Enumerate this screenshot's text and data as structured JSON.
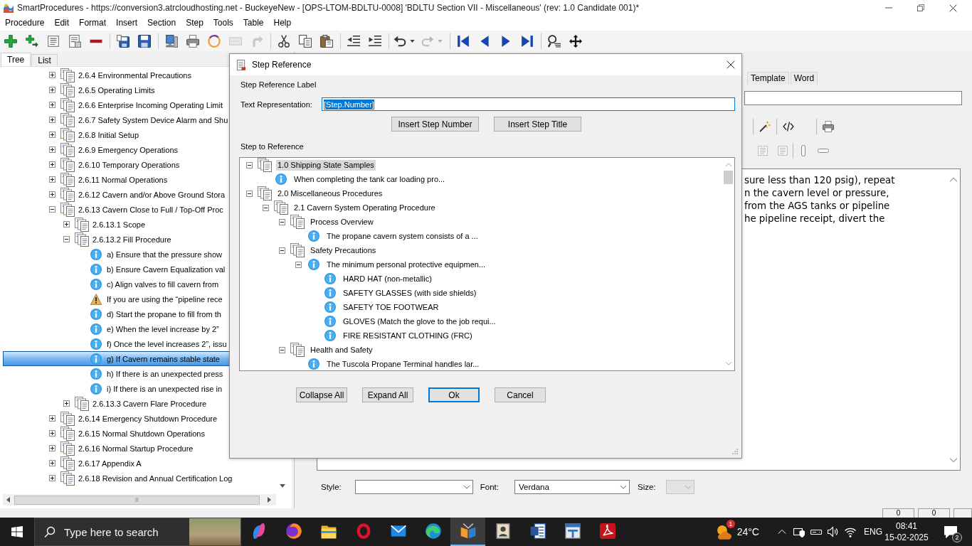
{
  "window": {
    "title": "SmartProcedures - https://conversion3.atrcloudhosting.net - BuckeyeNew - [OPS-LTOM-BDLTU-0008] 'BDLTU Section VII - Miscellaneous' (rev: 1.0 Candidate 001)*"
  },
  "menu": [
    "Procedure",
    "Edit",
    "Format",
    "Insert",
    "Section",
    "Step",
    "Tools",
    "Table",
    "Help"
  ],
  "toolbar": [
    {
      "kind": "plus",
      "disabled": false
    },
    {
      "kind": "plus-arrow",
      "disabled": false
    },
    {
      "kind": "list",
      "disabled": false
    },
    {
      "kind": "list-doc",
      "disabled": false
    },
    {
      "kind": "minus",
      "disabled": false
    },
    {
      "kind": "separator"
    },
    {
      "kind": "save-as",
      "disabled": false
    },
    {
      "kind": "save",
      "disabled": false
    },
    {
      "kind": "separator"
    },
    {
      "kind": "monitor",
      "disabled": false
    },
    {
      "kind": "printer",
      "disabled": false
    },
    {
      "kind": "ring",
      "disabled": false
    },
    {
      "kind": "card",
      "disabled": true
    },
    {
      "kind": "curve-arrow",
      "disabled": true
    },
    {
      "kind": "separator"
    },
    {
      "kind": "scissors",
      "disabled": false
    },
    {
      "kind": "copy",
      "disabled": false
    },
    {
      "kind": "paste",
      "disabled": false
    },
    {
      "kind": "separator"
    },
    {
      "kind": "outdent",
      "disabled": false
    },
    {
      "kind": "indent",
      "disabled": false
    },
    {
      "kind": "separator"
    },
    {
      "kind": "undo",
      "disabled": false
    },
    {
      "kind": "redo",
      "disabled": true
    },
    {
      "kind": "separator"
    },
    {
      "kind": "first",
      "disabled": false
    },
    {
      "kind": "prev",
      "disabled": false
    },
    {
      "kind": "next",
      "disabled": false
    },
    {
      "kind": "last",
      "disabled": false
    },
    {
      "kind": "separator"
    },
    {
      "kind": "find",
      "disabled": false
    },
    {
      "kind": "move",
      "disabled": false
    }
  ],
  "left_pane": {
    "tabs": [
      {
        "label": "Tree",
        "selected": true
      },
      {
        "label": "List",
        "selected": false
      }
    ],
    "tree": [
      {
        "label": "2.6.4 Environmental Precautions",
        "kind": "section",
        "expanded": false,
        "selected": false
      },
      {
        "label": "2.6.5 Operating Limits",
        "kind": "section",
        "expanded": false,
        "selected": false
      },
      {
        "label": "2.6.6 Enterprise Incoming Operating Limit",
        "kind": "section",
        "expanded": false,
        "selected": false
      },
      {
        "label": "2.6.7 Safety System Device Alarm and Shu",
        "kind": "section",
        "expanded": false,
        "selected": false
      },
      {
        "label": "2.6.8 Initial Setup",
        "kind": "section",
        "expanded": false,
        "selected": false
      },
      {
        "label": "2.6.9 Emergency Operations",
        "kind": "section",
        "expanded": false,
        "selected": false
      },
      {
        "label": "2.6.10 Temporary Operations",
        "kind": "section",
        "expanded": false,
        "selected": false
      },
      {
        "label": "2.6.11 Normal Operations",
        "kind": "section",
        "expanded": false,
        "selected": false
      },
      {
        "label": "2.6.12 Cavern and/or Above Ground Stora",
        "kind": "section",
        "expanded": false,
        "selected": false
      },
      {
        "label": "2.6.13 Cavern Close to Full / Top-Off Proc",
        "kind": "section",
        "expanded": true,
        "selected": false,
        "children": [
          {
            "label": "2.6.13.1 Scope",
            "kind": "section",
            "expanded": false,
            "selected": false
          },
          {
            "label": "2.6.13.2 Fill Procedure",
            "kind": "section",
            "expanded": true,
            "selected": false,
            "children": [
              {
                "label": "a) Ensure that the pressure show",
                "kind": "info",
                "selected": false
              },
              {
                "label": "b) Ensure Cavern Equalization val",
                "kind": "info",
                "selected": false
              },
              {
                "label": "c) Align valves to fill cavern from",
                "kind": "info",
                "selected": false
              },
              {
                "label": "If you are using the “pipeline rece",
                "kind": "warning",
                "selected": false
              },
              {
                "label": "d) Start the propane to fill from th",
                "kind": "info",
                "selected": false
              },
              {
                "label": "e) When the level increase by 2”",
                "kind": "info",
                "selected": false
              },
              {
                "label": "f) Once the level increases 2”, issu",
                "kind": "info",
                "selected": false
              },
              {
                "label": "g) If Cavern remains stable state",
                "kind": "info",
                "selected": true
              },
              {
                "label": "h) If there is an unexpected press",
                "kind": "info",
                "selected": false
              },
              {
                "label": "i) If there is an unexpected rise in",
                "kind": "info",
                "selected": false
              }
            ]
          },
          {
            "label": "2.6.13.3 Cavern Flare Procedure",
            "kind": "section",
            "expanded": false,
            "selected": false
          }
        ]
      },
      {
        "label": "2.6.14 Emergency Shutdown Procedure",
        "kind": "section",
        "expanded": false,
        "selected": false
      },
      {
        "label": "2.6.15 Normal Shutdown Operations",
        "kind": "section",
        "expanded": false,
        "selected": false
      },
      {
        "label": "2.6.16 Normal Startup Procedure",
        "kind": "section",
        "expanded": false,
        "selected": false
      },
      {
        "label": "2.6.17 Appendix A",
        "kind": "section",
        "expanded": false,
        "selected": false
      },
      {
        "label": "2.6.18 Revision and Annual Certification Log",
        "kind": "section",
        "expanded": false,
        "selected": false
      }
    ]
  },
  "editor_pane": {
    "tabs": [
      {
        "label": "Template",
        "selected": false
      },
      {
        "label": "Word",
        "selected": false
      }
    ],
    "toolbar_rows": [
      [
        {
          "kind": "separator"
        },
        {
          "kind": "wand",
          "disabled": false
        },
        {
          "kind": "separator"
        },
        {
          "kind": "code",
          "disabled": false
        },
        {
          "kind": "separator"
        },
        {
          "kind": "printer",
          "disabled": false
        }
      ],
      [
        {
          "kind": "list",
          "disabled": true
        },
        {
          "kind": "list",
          "disabled": true
        },
        {
          "kind": "separator"
        },
        {
          "kind": "vpill",
          "disabled": false
        },
        {
          "kind": "hpill",
          "disabled": false
        }
      ]
    ],
    "lines": [
      "sure less than 120 psig), repeat",
      "n the cavern level or pressure,",
      "from the AGS tanks or pipeline",
      "he pipeline receipt, divert the"
    ],
    "style_box": {
      "label": "Style:"
    },
    "font_box": {
      "label": "Font:",
      "value": "Verdana"
    },
    "size_box": {
      "label": "Size:",
      "disabled": true
    }
  },
  "dialog": {
    "title": "Step Reference",
    "label_section": "Step Reference Label",
    "text_label": "Text Representation:",
    "text_value": "[Step.Number]",
    "text_value_selected": true,
    "insert_buttons": [
      "Insert Step Number",
      "Insert Step Title"
    ],
    "tree_section": "Step to Reference",
    "tree": [
      {
        "label": "1.0 Shipping State Samples",
        "kind": "section",
        "expanded": true,
        "selected": true,
        "children": [
          {
            "label": "When completing the tank car loading pro...",
            "kind": "info",
            "selected": false
          }
        ]
      },
      {
        "label": "2.0 Miscellaneous Procedures",
        "kind": "section",
        "expanded": true,
        "selected": false,
        "children": [
          {
            "label": "2.1 Cavern System Operating Procedure",
            "kind": "section",
            "expanded": true,
            "selected": false,
            "children": [
              {
                "label": "Process Overview",
                "kind": "section",
                "expanded": true,
                "selected": false,
                "children": [
                  {
                    "label": "The propane cavern system consists of a ...",
                    "kind": "info",
                    "selected": false
                  }
                ]
              },
              {
                "label": "Safety Precautions",
                "kind": "section",
                "expanded": true,
                "selected": false,
                "children": [
                  {
                    "label": "The minimum personal protective equipmen...",
                    "kind": "info",
                    "expanded": true,
                    "selected": false,
                    "children": [
                      {
                        "label": "HARD HAT (non-metallic)",
                        "kind": "info",
                        "selected": false
                      },
                      {
                        "label": "SAFETY GLASSES (with side shields)",
                        "kind": "info",
                        "selected": false
                      },
                      {
                        "label": "SAFETY TOE FOOTWEAR",
                        "kind": "info",
                        "selected": false
                      },
                      {
                        "label": "GLOVES (Match the glove to the job requi...",
                        "kind": "info",
                        "selected": false
                      },
                      {
                        "label": "FIRE RESISTANT CLOTHING (FRC)",
                        "kind": "info",
                        "selected": false
                      }
                    ]
                  }
                ]
              },
              {
                "label": "Health and Safety",
                "kind": "section",
                "expanded": true,
                "selected": false,
                "children": [
                  {
                    "label": "The Tuscola Propane Terminal handles lar...",
                    "kind": "info",
                    "selected": false
                  }
                ]
              }
            ]
          }
        ]
      }
    ],
    "buttons": [
      {
        "label": "Collapse All",
        "default": false
      },
      {
        "label": "Expand All",
        "default": false
      },
      {
        "label": "Ok",
        "default": true
      },
      {
        "label": "Cancel",
        "default": false
      }
    ]
  },
  "status_bar": [
    "0",
    "0"
  ],
  "taskbar": {
    "search": {
      "placeholder": "Type here to search"
    },
    "apps": [
      {
        "kind": "swirl",
        "active": false
      },
      {
        "kind": "fox",
        "active": false
      },
      {
        "kind": "folder",
        "active": false
      },
      {
        "kind": "ring-o",
        "active": false
      },
      {
        "kind": "mail",
        "active": false
      },
      {
        "kind": "edge",
        "active": false
      },
      {
        "kind": "fan",
        "active": true
      },
      {
        "kind": "idcard",
        "active": false
      },
      {
        "kind": "docw",
        "active": false
      },
      {
        "kind": "tool",
        "active": false
      },
      {
        "kind": "pdf",
        "active": false
      }
    ],
    "weather": {
      "temperature": "24°C",
      "badge": "1"
    },
    "language": "ENG",
    "time": "08:41",
    "date": "15-02-2025",
    "notifications": "2"
  }
}
